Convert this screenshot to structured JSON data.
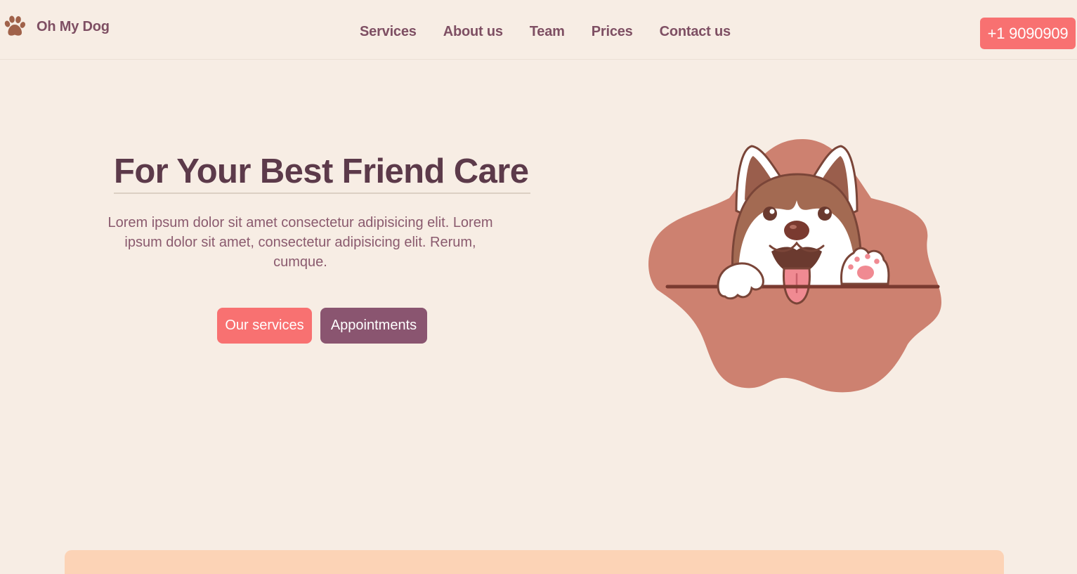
{
  "brand": {
    "name": "Oh My Dog",
    "icon": "paw-icon",
    "color": "#a0624a"
  },
  "nav": {
    "items": [
      {
        "label": "Services"
      },
      {
        "label": "About us"
      },
      {
        "label": "Team"
      },
      {
        "label": "Prices"
      },
      {
        "label": "Contact us"
      }
    ]
  },
  "phone": {
    "label": "+1 9090909"
  },
  "hero": {
    "title": "For Your Best Friend Care",
    "text": "Lorem ipsum dolor sit amet consectetur adipisicing elit. Lorem ipsum dolor sit amet, consectetur adipisicing elit. Rerum, cumque.",
    "primary_button": "Our services",
    "secondary_button": "Appointments",
    "illustration": "husky-dog-illustration"
  },
  "colors": {
    "background": "#f7ede4",
    "accent": "#f87171",
    "secondary": "#8a5570",
    "text": "#7e4f63",
    "title": "#5c3a4a",
    "blob": "#cd8170",
    "card": "#fcd3b6"
  }
}
